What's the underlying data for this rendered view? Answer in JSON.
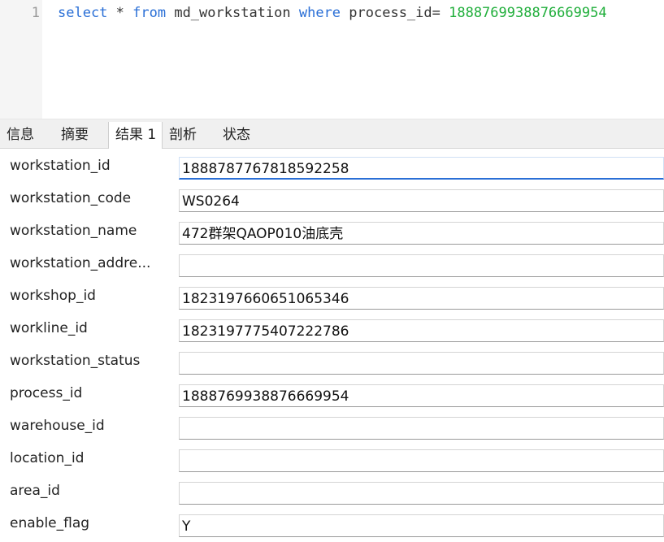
{
  "editor": {
    "line_number": "1",
    "code": {
      "kw_select": "select",
      "star": " * ",
      "kw_from": "from",
      "table": " md_workstation ",
      "kw_where": "where",
      "column": " process_id= ",
      "value": "1888769938876669954"
    }
  },
  "tabs": [
    {
      "label": "信息"
    },
    {
      "label": "摘要"
    },
    {
      "label": "结果 1"
    },
    {
      "label": "剖析"
    },
    {
      "label": "状态"
    }
  ],
  "active_tab_index": 2,
  "record": [
    {
      "label": "workstation_id",
      "value": "1888787767818592258"
    },
    {
      "label": "workstation_code",
      "value": "WS0264"
    },
    {
      "label": "workstation_name",
      "value": "472群架QAOP010油底壳"
    },
    {
      "label": "workstation_addre...",
      "value": ""
    },
    {
      "label": "workshop_id",
      "value": "1823197660651065346"
    },
    {
      "label": "workline_id",
      "value": "1823197775407222786"
    },
    {
      "label": "workstation_status",
      "value": ""
    },
    {
      "label": "process_id",
      "value": "1888769938876669954"
    },
    {
      "label": "warehouse_id",
      "value": ""
    },
    {
      "label": "location_id",
      "value": ""
    },
    {
      "label": "area_id",
      "value": ""
    },
    {
      "label": "enable_flag",
      "value": "Y"
    }
  ],
  "colors": {
    "keyword": "#2a6fd6",
    "number_literal": "#1fae3a",
    "focus_underline": "#2a6fd6"
  }
}
